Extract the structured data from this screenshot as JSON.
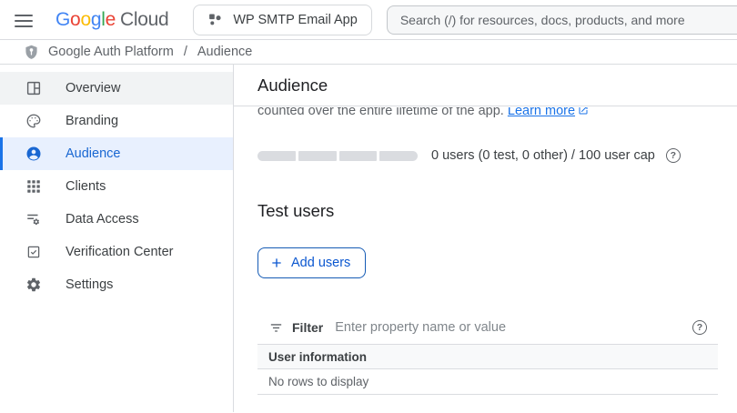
{
  "colors": {
    "accent": "#1a73e8",
    "selected_bg": "#e8f0fe",
    "selected_text": "#1967d2",
    "link": "#1a73e8",
    "button_text": "#0b57d0",
    "border": "#dadce0",
    "table_header_bg": "#f8f9fa"
  },
  "topbar": {
    "logo": {
      "l1": "G",
      "l2": "o",
      "l3": "o",
      "l4": "g",
      "l5": "l",
      "l6": "e",
      "suffix": "Cloud"
    },
    "project_button_label": "WP SMTP Email App",
    "search_placeholder": "Search (/) for resources, docs, products, and more"
  },
  "breadcrumb": {
    "root": "Google Auth Platform",
    "separator": "/",
    "current": "Audience"
  },
  "sidebar": {
    "items": [
      {
        "label": "Overview",
        "icon": "overview-icon"
      },
      {
        "label": "Branding",
        "icon": "palette-icon"
      },
      {
        "label": "Audience",
        "icon": "person-icon",
        "selected": true
      },
      {
        "label": "Clients",
        "icon": "apps-grid-icon"
      },
      {
        "label": "Data Access",
        "icon": "list-gear-icon"
      },
      {
        "label": "Verification Center",
        "icon": "checkbox-icon"
      },
      {
        "label": "Settings",
        "icon": "gear-icon"
      }
    ]
  },
  "main": {
    "page_title": "Audience",
    "clipped_sentence": "counted over the entire lifetime of the app. ",
    "learn_more_label": "Learn more",
    "user_cap": {
      "summary": "0 users (0 test, 0 other) / 100 user cap",
      "users": 0,
      "test_users": 0,
      "other_users": 0,
      "cap": 100,
      "segments": 4
    },
    "test_users_heading": "Test users",
    "add_users_label": "Add users",
    "filter": {
      "label": "Filter",
      "placeholder": "Enter property name or value"
    },
    "table": {
      "header": "User information",
      "empty_message": "No rows to display"
    }
  }
}
